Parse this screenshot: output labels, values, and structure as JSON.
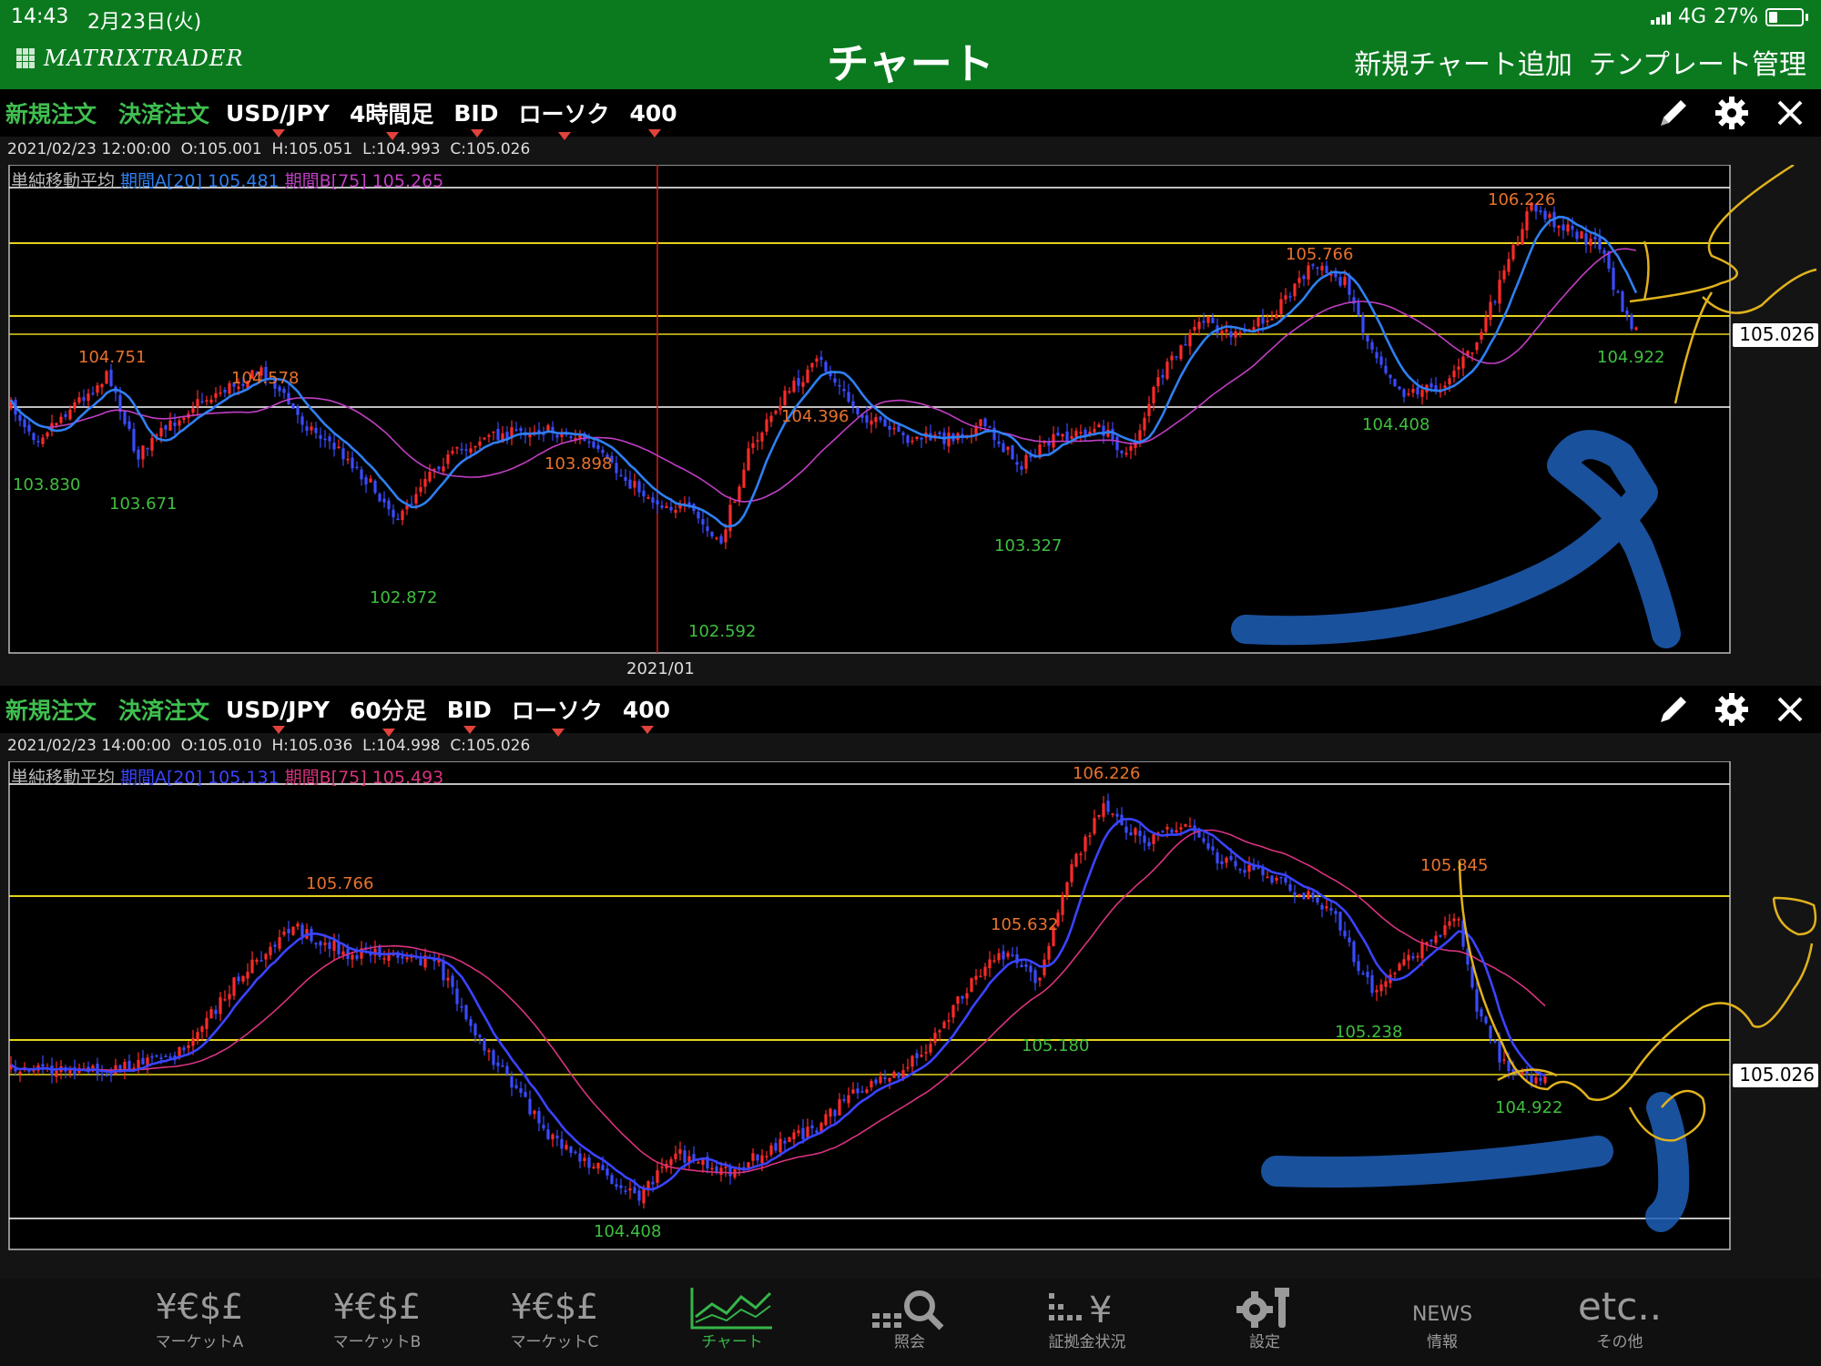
{
  "status_bar": {
    "time": "14:43",
    "date": "2月23日(火)",
    "network": "4G",
    "battery": "27%"
  },
  "header": {
    "logo_text": "MATRIXTRADER",
    "title": "チャート",
    "actions": [
      "新規チャート追加",
      "テンプレート管理"
    ]
  },
  "charts": [
    {
      "toolbar": {
        "new_order": "新規注文",
        "close_order": "決済注文",
        "pair": "USD/JPY",
        "timeframe": "4時間足",
        "price_type": "BID",
        "chart_style": "ローソク",
        "bars": "400"
      },
      "ohlc": {
        "datetime": "2021/02/23 12:00:00",
        "open": "O:105.001",
        "high": "H:105.051",
        "low": "L:104.993",
        "close": "C:105.026"
      },
      "ma_legend": {
        "name": "単純移動平均",
        "a": "期間A[20] 105.481",
        "b": "期間B[75] 105.265"
      },
      "price_tag": "105.026",
      "axis_label": "2021/01",
      "labels": [
        "104.751",
        "104.578",
        "103.898",
        "104.396",
        "105.766",
        "106.226",
        "103.830",
        "103.671",
        "102.872",
        "102.592",
        "103.327",
        "104.408",
        "104.922"
      ]
    },
    {
      "toolbar": {
        "new_order": "新規注文",
        "close_order": "決済注文",
        "pair": "USD/JPY",
        "timeframe": "60分足",
        "price_type": "BID",
        "chart_style": "ローソク",
        "bars": "400"
      },
      "ohlc": {
        "datetime": "2021/02/23 14:00:00",
        "open": "O:105.010",
        "high": "H:105.036",
        "low": "L:104.998",
        "close": "C:105.026"
      },
      "ma_legend": {
        "name": "単純移動平均",
        "a": "期間A[20] 105.131",
        "b": "期間B[75] 105.493"
      },
      "price_tag": "105.026",
      "labels": [
        "105.766",
        "106.226",
        "105.632",
        "105.845",
        "105.180",
        "105.238",
        "104.922",
        "104.408"
      ]
    }
  ],
  "tabbar": [
    {
      "icon": "¥€$£",
      "label": "マーケットA"
    },
    {
      "icon": "¥€$£",
      "label": "マーケットB"
    },
    {
      "icon": "¥€$£",
      "label": "マーケットC"
    },
    {
      "icon": "",
      "label": "チャート"
    },
    {
      "icon": "",
      "label": "照会"
    },
    {
      "icon": "¥",
      "label": "証拠金状況"
    },
    {
      "icon": "",
      "label": "設定"
    },
    {
      "icon": "NEWS",
      "label": "情報"
    },
    {
      "icon": "etc..",
      "label": "その他"
    }
  ],
  "colors": {
    "header_green": "#0b7a1f",
    "order_green": "#3fbf4f",
    "candle_up": "#ff2a2a",
    "candle_down": "#3a4bff",
    "ma_a_chart1": "#2f7ff2",
    "ma_b_chart1": "#c13ec4",
    "ma_a_chart2": "#3a44ff",
    "ma_b_chart2": "#d8337d",
    "high_label": "#e8722c",
    "low_label": "#3fbf3f",
    "hline_yellow": "#e6d21e",
    "drawing_blue": "#1f5fb8",
    "drawing_yellow": "#e0b21c"
  }
}
